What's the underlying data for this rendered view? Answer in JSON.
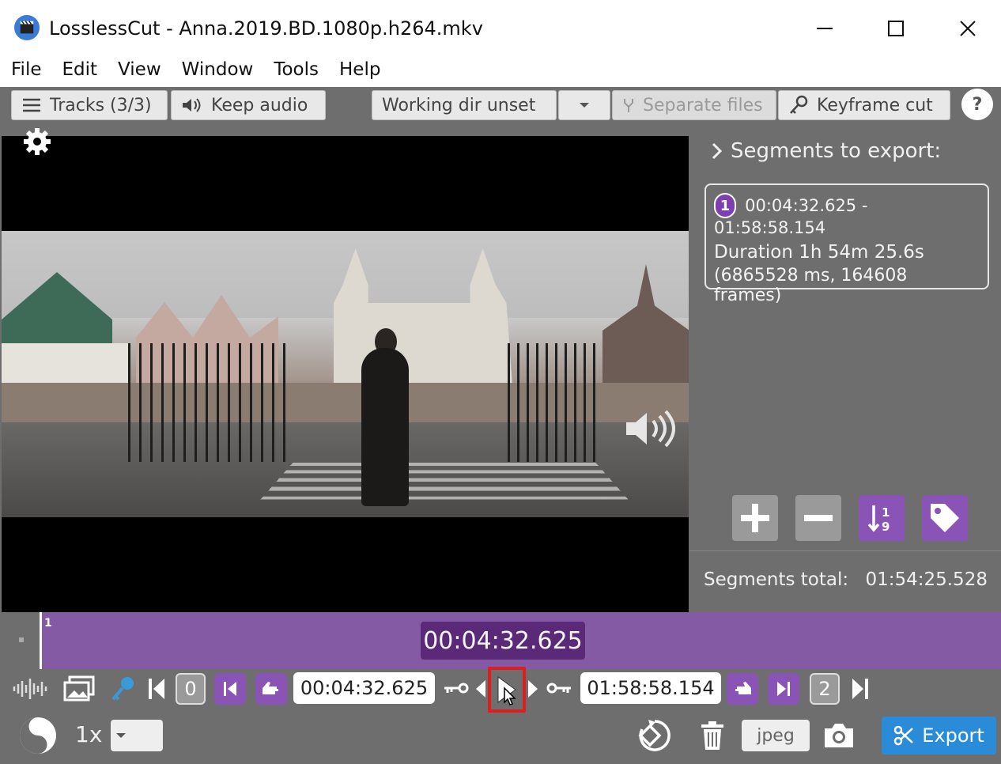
{
  "window": {
    "title": "LosslessCut - Anna.2019.BD.1080p.h264.mkv"
  },
  "menu": [
    "File",
    "Edit",
    "View",
    "Window",
    "Tools",
    "Help"
  ],
  "toolbar": {
    "tracks_label": "Tracks (3/3)",
    "keep_audio_label": "Keep audio",
    "working_dir_label": "Working dir unset",
    "separate_files_label": "Separate files",
    "keyframe_cut_label": "Keyframe cut",
    "help_label": "?"
  },
  "segments": {
    "header": "Segments to export:",
    "items": [
      {
        "number": "1",
        "range": "00:04:32.625 - 01:58:58.154",
        "duration": "Duration 1h 54m 25.6s",
        "detail": "(6865528 ms, 164608 frames)"
      }
    ],
    "total_label": "Segments total:",
    "total_value": "01:54:25.528"
  },
  "timeline": {
    "segment_number": "1",
    "current_time": "00:04:32.625"
  },
  "controls": {
    "start_marker_label": "0",
    "cut_start_time": "00:04:32.625",
    "cut_end_time": "01:58:58.154",
    "end_marker_label": "2",
    "speed_label": "1x",
    "capture_format": "jpeg",
    "export_label": "Export"
  },
  "colors": {
    "accent_purple": "#845aa5",
    "dark_purple": "#5a2a78",
    "export_blue": "#2a8bd8",
    "panel_grey": "#6e6e6e"
  }
}
